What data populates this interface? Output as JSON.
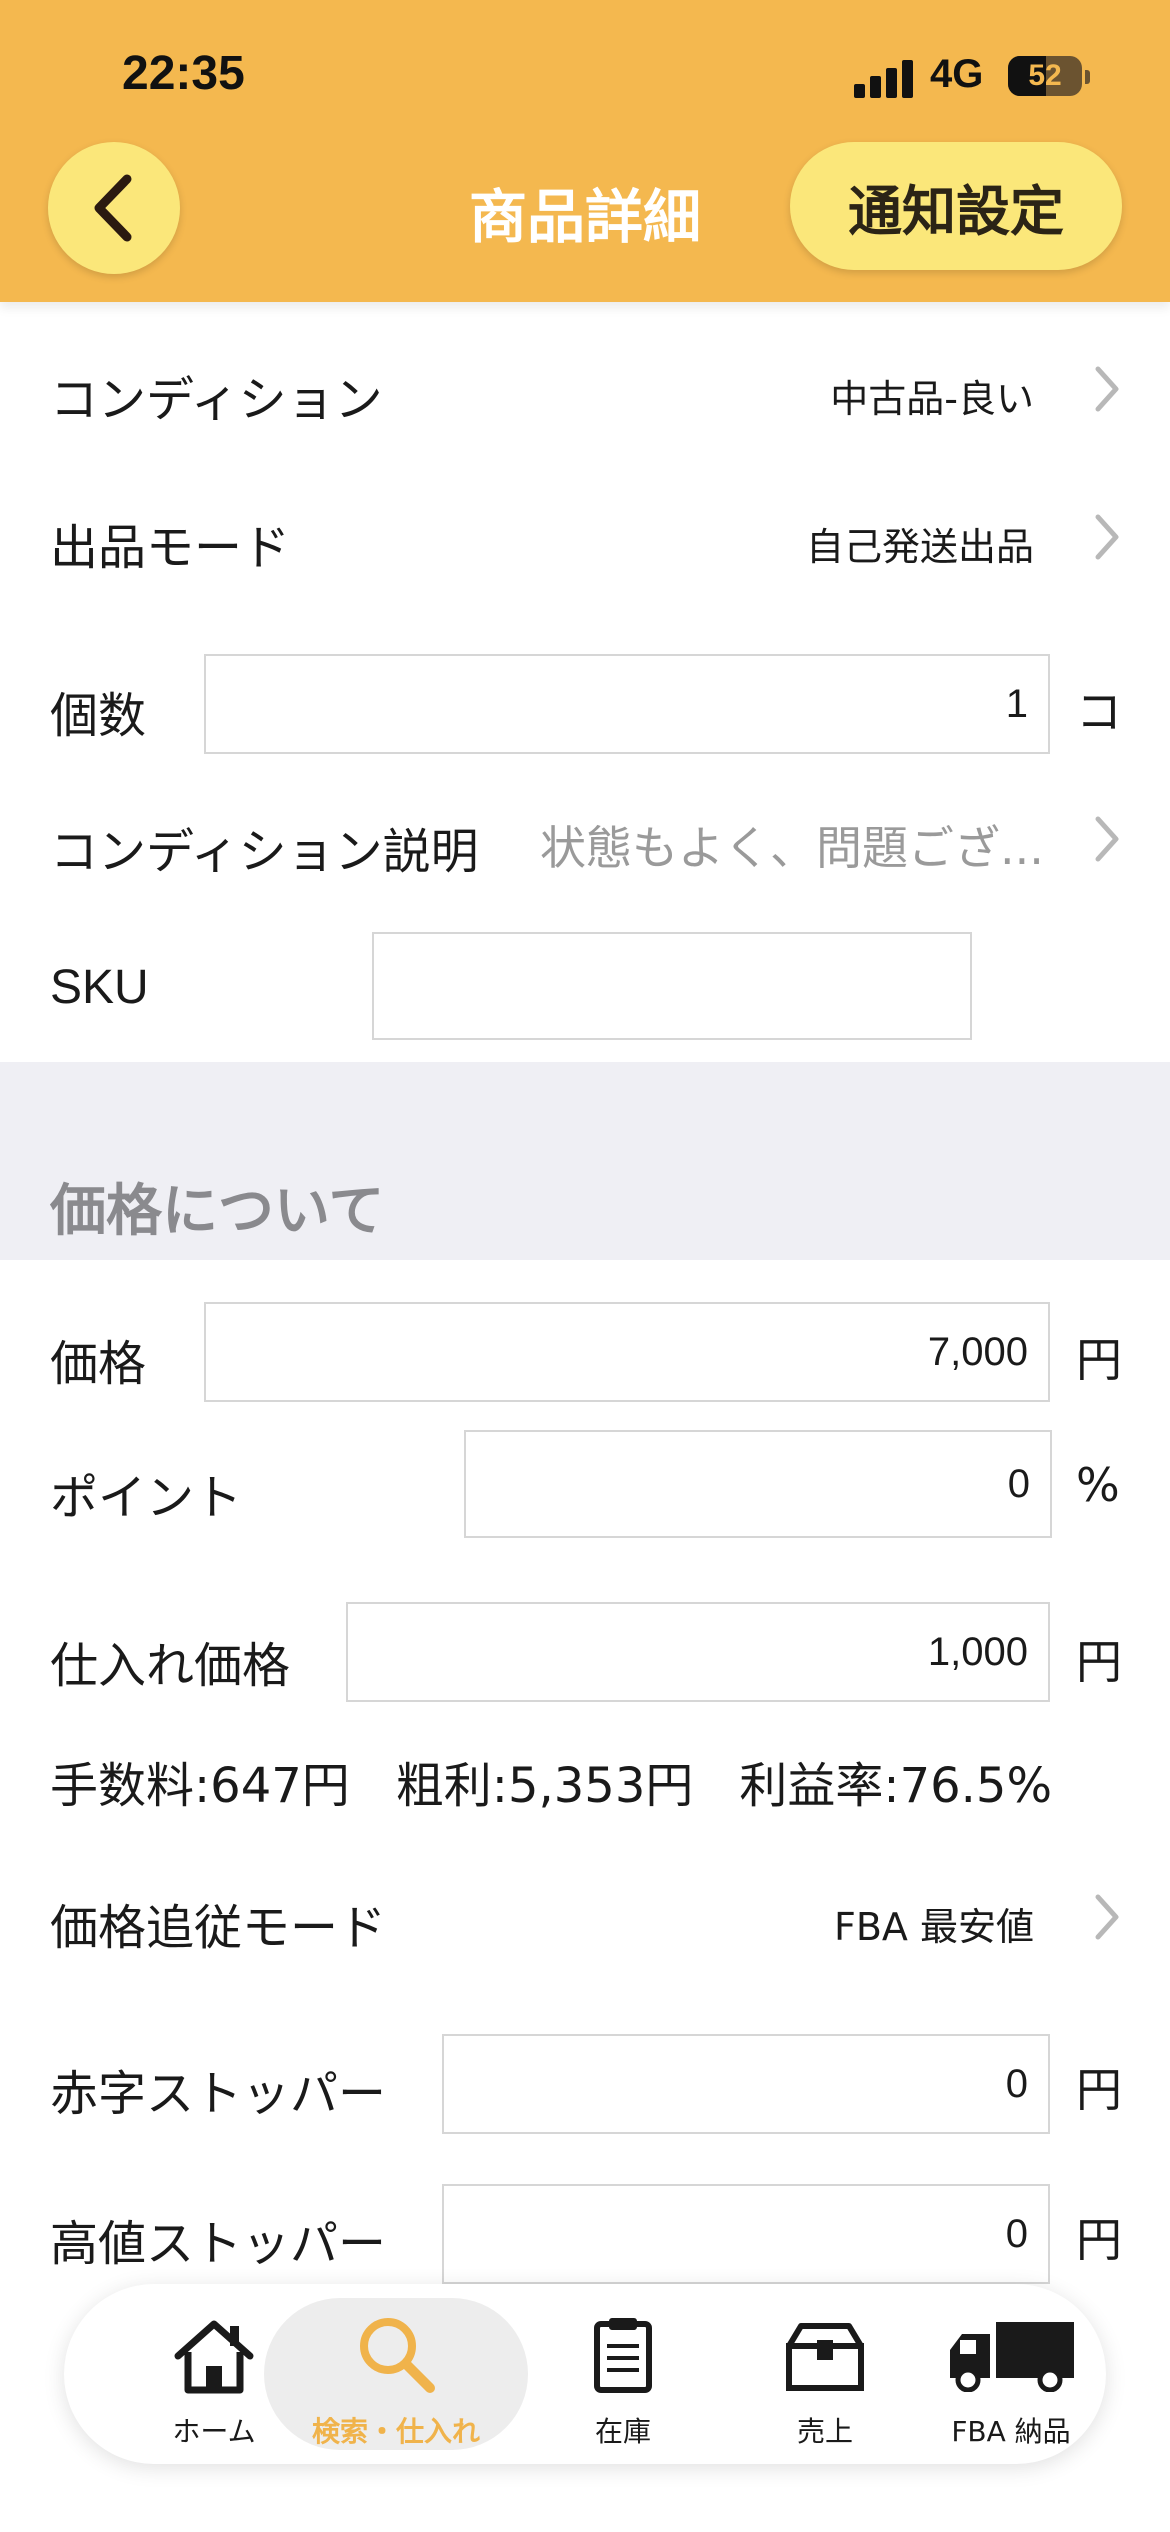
{
  "status_bar": {
    "time": "22:35",
    "network": "4G",
    "battery_percent": "52",
    "battery_level": 0.52
  },
  "header": {
    "title": "商品詳細",
    "back_icon": "chevron-left-icon",
    "notify_button": "通知設定"
  },
  "listing": {
    "condition_label": "コンディション",
    "condition_value": "中古品-良い",
    "mode_label": "出品モード",
    "mode_value": "自己発送出品",
    "quantity_label": "個数",
    "quantity_value": "1",
    "quantity_unit": "コ",
    "description_label": "コンディション説明",
    "description_value": "状態もよく、問題ござ...",
    "sku_label": "SKU",
    "sku_value": ""
  },
  "pricing": {
    "section_title": "価格について",
    "price_label": "価格",
    "price_value": "7,000",
    "price_unit": "円",
    "point_label": "ポイント",
    "point_value": "0",
    "point_unit": "%",
    "cost_label": "仕入れ価格",
    "cost_value": "1,000",
    "cost_unit": "円",
    "fee_text": "手数料:647円",
    "profit_text": "粗利:5,353円",
    "margin_text": "利益率:76.5%",
    "tracking_label": "価格追従モード",
    "tracking_value": "FBA 最安値",
    "loss_stopper_label": "赤字ストッパー",
    "loss_stopper_value": "0",
    "loss_stopper_unit": "円",
    "high_stopper_label": "高値ストッパー",
    "high_stopper_value": "0",
    "high_stopper_unit": "円"
  },
  "tabbar": {
    "active_color": "#F0B34B",
    "items": [
      {
        "label": "ホーム",
        "icon": "home-icon"
      },
      {
        "label": "検索・仕入れ",
        "icon": "search-icon",
        "active": true
      },
      {
        "label": "在庫",
        "icon": "clipboard-icon"
      },
      {
        "label": "売上",
        "icon": "box-icon"
      },
      {
        "label": "FBA 納品",
        "icon": "truck-icon"
      }
    ]
  },
  "colors": {
    "header_bg": "#F4B84F",
    "button_bg": "#FBE77A",
    "section_bg": "#EFEFF4"
  }
}
